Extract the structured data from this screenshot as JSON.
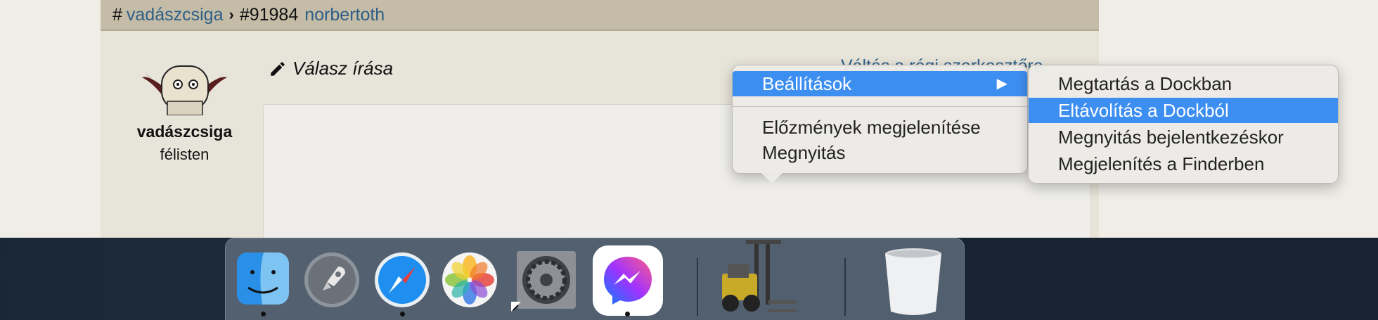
{
  "breadcrumb": {
    "hash": "#",
    "author": "vadászcsiga",
    "topic_number": "#91984",
    "recipient": "norbertoth"
  },
  "user": {
    "name": "vadászcsiga",
    "rank": "félisten"
  },
  "reply": {
    "heading": "Válasz írása",
    "switch_editor": "Váltás a régi szerkesztőre"
  },
  "context_menu": {
    "items": [
      {
        "label": "Beállítások",
        "has_submenu": true,
        "highlighted": true
      },
      {
        "label": "Előzmények megjelenítése"
      },
      {
        "label": "Megnyitás"
      }
    ],
    "submenu_arrow": "▶"
  },
  "submenu": {
    "items": [
      {
        "label": "Megtartás a Dockban"
      },
      {
        "label": "Eltávolítás a Dockból",
        "highlighted": true
      },
      {
        "label": "Megnyitás bejelentkezéskor"
      },
      {
        "label": "Megjelenítés a Finderben"
      }
    ]
  },
  "dock": {
    "apps": [
      {
        "icon": "finder-icon",
        "running": true
      },
      {
        "icon": "launchpad-icon",
        "running": false
      },
      {
        "icon": "safari-icon",
        "running": true
      },
      {
        "icon": "photos-icon",
        "running": false
      },
      {
        "icon": "system-preferences-icon",
        "running": false,
        "alias": true
      },
      {
        "icon": "messenger-icon",
        "running": true
      },
      {
        "icon": "forklift-icon",
        "running": false
      },
      {
        "icon": "trash-icon",
        "running": false
      }
    ]
  },
  "colors": {
    "menu_highlight": "#3d8ef1",
    "link": "#2f5f86",
    "breadcrumb_bg": "#c4bca7"
  }
}
